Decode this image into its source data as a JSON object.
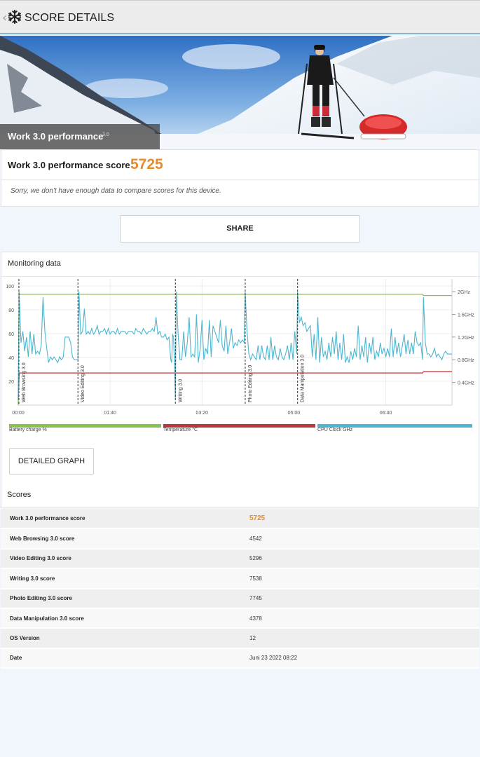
{
  "appbar": {
    "title": "SCORE DETAILS",
    "back_icon": "chevron-left-icon",
    "logo_icon": "snowflake-icon"
  },
  "hero": {
    "title": "Work 3.0 performance",
    "version": "3.0"
  },
  "score": {
    "label": "Work 3.0 performance score",
    "value": "5725",
    "note": "Sorry, we don't have enough data to compare scores for this device."
  },
  "share_label": "SHARE",
  "monitoring": {
    "title": "Monitoring data",
    "legend": [
      {
        "label": "Battery charge %",
        "color": "#8bc34a"
      },
      {
        "label": "Temperature °C",
        "color": "#b5393d"
      },
      {
        "label": "CPU Clock GHz",
        "color": "#4db6d0"
      }
    ]
  },
  "chart_data": {
    "type": "line",
    "title": "",
    "xlabel": "",
    "x_ticks": [
      "00:00",
      "01:40",
      "03:20",
      "05:00",
      "06:40"
    ],
    "x_tick_seconds": [
      0,
      100,
      200,
      300,
      400
    ],
    "xlim_seconds": [
      0,
      472
    ],
    "y_left_ticks": [
      "100",
      "80",
      "60",
      "40",
      "20"
    ],
    "y_left_lim": [
      0,
      100
    ],
    "y_right_ticks": [
      "2GHz",
      "1.6GHz",
      "1.2GHz",
      "0.8GHz",
      "0.4GHz"
    ],
    "y_right_lim_ghz": [
      0,
      2.1
    ],
    "grid": true,
    "markers": [
      {
        "label": "Web Browsing 3.0",
        "t": 0
      },
      {
        "label": "Video Editing 3.0",
        "t": 65
      },
      {
        "label": "Writing 3.0",
        "t": 171
      },
      {
        "label": "Photo Editing 3.0",
        "t": 247
      },
      {
        "label": "Data Manipulation 3.0",
        "t": 304
      }
    ],
    "series": [
      {
        "name": "Battery charge %",
        "axis": "left",
        "color": "#8bc34a",
        "points": [
          [
            0,
            0
          ],
          [
            1,
            93
          ],
          [
            65,
            93
          ],
          [
            66,
            93
          ],
          [
            171,
            93
          ],
          [
            172,
            93
          ],
          [
            440,
            93
          ],
          [
            441,
            92
          ],
          [
            472,
            92
          ]
        ]
      },
      {
        "name": "Temperature °C",
        "axis": "left",
        "color": "#b5393d",
        "points": [
          [
            0,
            5
          ],
          [
            1,
            27
          ],
          [
            171,
            27
          ],
          [
            172,
            27
          ],
          [
            440,
            27
          ],
          [
            441,
            28
          ],
          [
            472,
            28
          ]
        ]
      },
      {
        "name": "CPU Clock GHz",
        "axis": "right",
        "color": "#4db6d0",
        "points": [
          [
            0,
            0.1
          ],
          [
            1,
            2.0
          ],
          [
            3,
            1.1
          ],
          [
            5,
            1.3
          ],
          [
            7,
            0.95
          ],
          [
            9,
            1.2
          ],
          [
            11,
            0.85
          ],
          [
            13,
            1.3
          ],
          [
            15,
            0.9
          ],
          [
            17,
            1.25
          ],
          [
            19,
            0.9
          ],
          [
            21,
            0.95
          ],
          [
            23,
            0.9
          ],
          [
            25,
            1.05
          ],
          [
            27,
            1.9
          ],
          [
            29,
            1.3
          ],
          [
            31,
            1.0
          ],
          [
            33,
            0.75
          ],
          [
            35,
            0.85
          ],
          [
            37,
            0.8
          ],
          [
            39,
            0.85
          ],
          [
            41,
            0.8
          ],
          [
            43,
            0.75
          ],
          [
            45,
            0.85
          ],
          [
            47,
            0.8
          ],
          [
            49,
            0.85
          ],
          [
            51,
            1.2
          ],
          [
            53,
            1.2
          ],
          [
            55,
            1.2
          ],
          [
            57,
            1.1
          ],
          [
            59,
            0.85
          ],
          [
            61,
            0.8
          ],
          [
            63,
            0.8
          ],
          [
            65,
            0.8
          ],
          [
            66,
            2.0
          ],
          [
            68,
            1.25
          ],
          [
            70,
            1.3
          ],
          [
            72,
            1.7
          ],
          [
            74,
            1.25
          ],
          [
            76,
            1.3
          ],
          [
            78,
            1.25
          ],
          [
            80,
            1.35
          ],
          [
            82,
            1.25
          ],
          [
            84,
            1.3
          ],
          [
            86,
            1.4
          ],
          [
            88,
            1.25
          ],
          [
            90,
            1.3
          ],
          [
            92,
            1.3
          ],
          [
            94,
            1.35
          ],
          [
            96,
            1.25
          ],
          [
            98,
            1.35
          ],
          [
            100,
            1.25
          ],
          [
            102,
            1.3
          ],
          [
            104,
            1.3
          ],
          [
            106,
            1.25
          ],
          [
            108,
            1.35
          ],
          [
            110,
            1.25
          ],
          [
            112,
            1.3
          ],
          [
            114,
            1.3
          ],
          [
            116,
            1.3
          ],
          [
            118,
            1.25
          ],
          [
            120,
            1.3
          ],
          [
            122,
            1.3
          ],
          [
            124,
            1.3
          ],
          [
            126,
            1.25
          ],
          [
            128,
            1.35
          ],
          [
            130,
            1.3
          ],
          [
            132,
            1.3
          ],
          [
            134,
            1.25
          ],
          [
            136,
            1.35
          ],
          [
            138,
            1.3
          ],
          [
            140,
            1.25
          ],
          [
            142,
            1.3
          ],
          [
            144,
            1.3
          ],
          [
            146,
            1.35
          ],
          [
            148,
            1.3
          ],
          [
            150,
            1.55
          ],
          [
            152,
            1.25
          ],
          [
            154,
            1.3
          ],
          [
            156,
            1.2
          ],
          [
            158,
            1.2
          ],
          [
            160,
            1.25
          ],
          [
            162,
            1.15
          ],
          [
            164,
            1.2
          ],
          [
            166,
            0.8
          ],
          [
            167,
            0.75
          ],
          [
            168,
            1.25
          ],
          [
            169,
            1.2
          ],
          [
            170,
            0.75
          ],
          [
            171,
            0.1
          ],
          [
            172,
            2.0
          ],
          [
            174,
            1.25
          ],
          [
            176,
            0.8
          ],
          [
            178,
            0.8
          ],
          [
            180,
            1.3
          ],
          [
            182,
            0.85
          ],
          [
            184,
            1.1
          ],
          [
            186,
            1.55
          ],
          [
            188,
            0.85
          ],
          [
            190,
            0.9
          ],
          [
            192,
            0.85
          ],
          [
            194,
            1.6
          ],
          [
            196,
            0.75
          ],
          [
            198,
            1.0
          ],
          [
            200,
            1.5
          ],
          [
            202,
            0.8
          ],
          [
            204,
            1.0
          ],
          [
            206,
            0.9
          ],
          [
            208,
            1.5
          ],
          [
            210,
            0.85
          ],
          [
            212,
            1.4
          ],
          [
            214,
            1.3
          ],
          [
            216,
            1.2
          ],
          [
            218,
            1.1
          ],
          [
            220,
            1.5
          ],
          [
            222,
            1.05
          ],
          [
            224,
            0.95
          ],
          [
            226,
            1.4
          ],
          [
            228,
            0.9
          ],
          [
            230,
            1.1
          ],
          [
            232,
            1.35
          ],
          [
            234,
            1.0
          ],
          [
            236,
            1.1
          ],
          [
            238,
            1.05
          ],
          [
            240,
            1.15
          ],
          [
            242,
            1.1
          ],
          [
            244,
            1.15
          ],
          [
            246,
            1.1
          ],
          [
            247,
            2.0
          ],
          [
            249,
            1.3
          ],
          [
            251,
            0.9
          ],
          [
            253,
            0.8
          ],
          [
            255,
            0.9
          ],
          [
            257,
            0.85
          ],
          [
            259,
            0.8
          ],
          [
            261,
            1.05
          ],
          [
            263,
            0.8
          ],
          [
            265,
            1.05
          ],
          [
            267,
            0.85
          ],
          [
            269,
            0.8
          ],
          [
            271,
            1.05
          ],
          [
            273,
            0.8
          ],
          [
            275,
            1.2
          ],
          [
            277,
            0.8
          ],
          [
            279,
            1.05
          ],
          [
            281,
            0.85
          ],
          [
            283,
            0.8
          ],
          [
            285,
            1.0
          ],
          [
            287,
            0.85
          ],
          [
            289,
            0.8
          ],
          [
            291,
            0.9
          ],
          [
            293,
            1.05
          ],
          [
            295,
            0.8
          ],
          [
            297,
            1.1
          ],
          [
            299,
            0.8
          ],
          [
            301,
            1.3
          ],
          [
            303,
            0.9
          ],
          [
            304,
            2.0
          ],
          [
            306,
            1.45
          ],
          [
            308,
            1.55
          ],
          [
            310,
            1.4
          ],
          [
            312,
            1.45
          ],
          [
            314,
            1.3
          ],
          [
            316,
            1.35
          ],
          [
            318,
            1.4
          ],
          [
            320,
            0.85
          ],
          [
            322,
            1.25
          ],
          [
            324,
            0.8
          ],
          [
            326,
            1.55
          ],
          [
            328,
            0.75
          ],
          [
            330,
            1.2
          ],
          [
            332,
            0.85
          ],
          [
            334,
            0.95
          ],
          [
            336,
            0.8
          ],
          [
            338,
            1.1
          ],
          [
            340,
            0.85
          ],
          [
            342,
            1.2
          ],
          [
            344,
            0.9
          ],
          [
            346,
            1.3
          ],
          [
            348,
            0.8
          ],
          [
            350,
            1.1
          ],
          [
            352,
            0.8
          ],
          [
            354,
            1.25
          ],
          [
            356,
            0.75
          ],
          [
            358,
            0.85
          ],
          [
            360,
            0.75
          ],
          [
            362,
            0.95
          ],
          [
            364,
            0.8
          ],
          [
            366,
            1.0
          ],
          [
            368,
            0.85
          ],
          [
            370,
            1.4
          ],
          [
            372,
            0.8
          ],
          [
            374,
            1.05
          ],
          [
            376,
            0.85
          ],
          [
            378,
            1.2
          ],
          [
            380,
            0.75
          ],
          [
            382,
            1.1
          ],
          [
            384,
            0.9
          ],
          [
            386,
            1.2
          ],
          [
            388,
            0.8
          ],
          [
            390,
            0.95
          ],
          [
            392,
            0.85
          ],
          [
            394,
            1.1
          ],
          [
            396,
            0.9
          ],
          [
            398,
            1.0
          ],
          [
            400,
            0.85
          ],
          [
            402,
            1.0
          ],
          [
            404,
            0.85
          ],
          [
            406,
            1.35
          ],
          [
            408,
            0.85
          ],
          [
            410,
            1.2
          ],
          [
            412,
            0.9
          ],
          [
            414,
            1.1
          ],
          [
            416,
            0.85
          ],
          [
            418,
            1.05
          ],
          [
            420,
            1.25
          ],
          [
            422,
            0.9
          ],
          [
            424,
            1.15
          ],
          [
            426,
            0.9
          ],
          [
            428,
            1.1
          ],
          [
            430,
            0.9
          ],
          [
            432,
            1.3
          ],
          [
            434,
            1.1
          ],
          [
            436,
            1.05
          ],
          [
            438,
            1.1
          ],
          [
            440,
            0.8
          ],
          [
            441,
            1.9
          ],
          [
            443,
            1.1
          ],
          [
            445,
            0.9
          ],
          [
            447,
            0.9
          ],
          [
            449,
            0.85
          ],
          [
            451,
            0.9
          ],
          [
            453,
            1.0
          ],
          [
            455,
            0.85
          ],
          [
            457,
            0.9
          ],
          [
            459,
            0.85
          ],
          [
            461,
            0.8
          ],
          [
            463,
            0.9
          ],
          [
            465,
            0.95
          ],
          [
            467,
            0.9
          ],
          [
            469,
            0.9
          ],
          [
            472,
            0.9
          ]
        ]
      }
    ]
  },
  "detailed_graph_label": "DETAILED GRAPH",
  "scores": {
    "title": "Scores",
    "rows": [
      {
        "name": "Work 3.0 performance score",
        "value": "5725"
      },
      {
        "name": "Web Browsing 3.0 score",
        "value": "4542"
      },
      {
        "name": "Video Editing 3.0 score",
        "value": "5296"
      },
      {
        "name": "Writing 3.0 score",
        "value": "7538"
      },
      {
        "name": "Photo Editing 3.0 score",
        "value": "7745"
      },
      {
        "name": "Data Manipulation 3.0 score",
        "value": "4378"
      },
      {
        "name": "OS Version",
        "value": "12"
      },
      {
        "name": "Date",
        "value": "Juni 23 2022 08:22"
      }
    ]
  }
}
